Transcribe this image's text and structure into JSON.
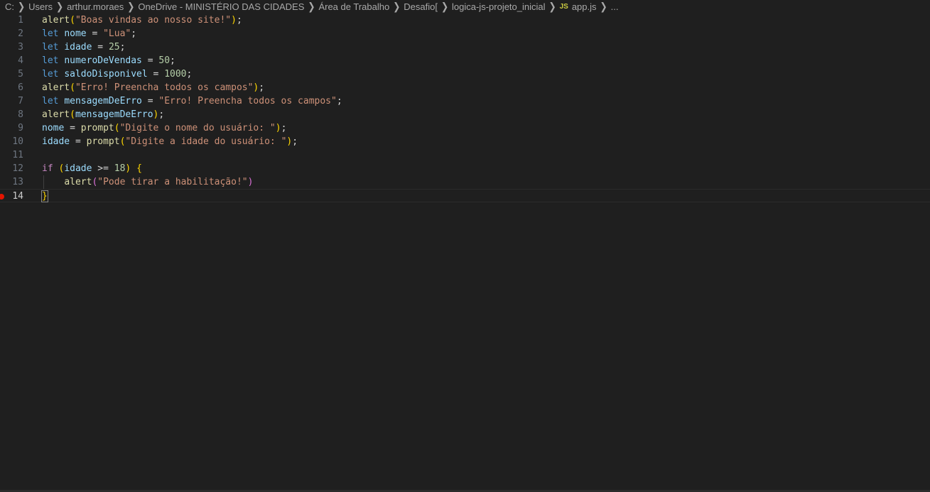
{
  "breadcrumb": {
    "items": [
      "C:",
      "Users",
      "arthur.moraes",
      "OneDrive - MINISTÉRIO DAS CIDADES",
      "Área de Trabalho",
      "Desafio[",
      "logica-js-projeto_inicial"
    ],
    "file_icon": "JS",
    "file_name": "app.js",
    "ellipsis": "..."
  },
  "editor": {
    "language": "javascript",
    "current_line": 14,
    "breakpoint_line": 14,
    "lines": [
      {
        "num": "1",
        "text": "alert(\"Boas vindas ao nosso site!\");"
      },
      {
        "num": "2",
        "text": "let nome = \"Lua\";"
      },
      {
        "num": "3",
        "text": "let idade = 25;"
      },
      {
        "num": "4",
        "text": "let numeroDeVendas = 50;"
      },
      {
        "num": "5",
        "text": "let saldoDisponivel = 1000;"
      },
      {
        "num": "6",
        "text": "alert(\"Erro! Preencha todos os campos\");"
      },
      {
        "num": "7",
        "text": "let mensagemDeErro = \"Erro! Preencha todos os campos\";"
      },
      {
        "num": "8",
        "text": "alert(mensagemDeErro);"
      },
      {
        "num": "9",
        "text": "nome = prompt(\"Digite o nome do usuário: \");"
      },
      {
        "num": "10",
        "text": "idade = prompt(\"Digite a idade do usuário: \");"
      },
      {
        "num": "11",
        "text": ""
      },
      {
        "num": "12",
        "text": "if (idade >= 18) {"
      },
      {
        "num": "13",
        "text": "    alert(\"Pode tirar a habilitação!\")"
      },
      {
        "num": "14",
        "text": "}"
      }
    ]
  },
  "colors": {
    "background": "#1f1f1f",
    "function": "#dcdcaa",
    "keyword": "#569cd6",
    "control": "#c586c0",
    "variable": "#9cdcfe",
    "string": "#ce9178",
    "number": "#b5cea8",
    "bracket_level1": "#ffd700",
    "bracket_level2": "#da70d6",
    "breakpoint": "#e51400"
  }
}
